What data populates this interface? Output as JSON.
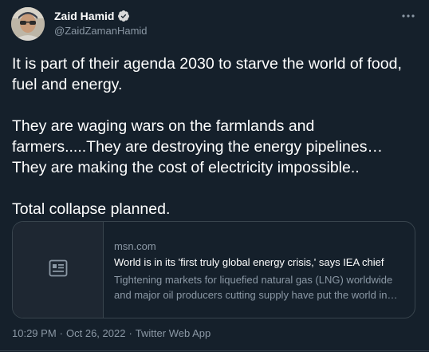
{
  "author": {
    "display_name": "Zaid Hamid",
    "handle": "@ZaidZamanHamid",
    "verified": true,
    "avatar_icon": "user-avatar-photo"
  },
  "tweet": {
    "paragraphs": [
      "It is part of their agenda 2030 to starve the world of food, fuel and energy.",
      "They are waging wars on the farmlands and farmers.....They are destroying the energy pipelines… They are making the cost of electricity impossible..",
      "Total collapse planned."
    ]
  },
  "link_card": {
    "domain": "msn.com",
    "title": "World is in its 'first truly global energy crisis,' says IEA chief",
    "description_line1": "Tightening markets for liquefied natural gas (LNG) worldwide",
    "description_line2": "and major oil producers cutting supply have put the world in…",
    "thumbnail_icon": "article-icon"
  },
  "meta": {
    "time": "10:29 PM",
    "separator": "·",
    "date": "Oct 26, 2022",
    "source": "Twitter Web App"
  },
  "colors": {
    "background": "#15202b",
    "text": "#ffffff",
    "secondary_text": "#8b98a5",
    "border": "#38444d",
    "verified_badge": "#d9d9d9"
  },
  "icons": {
    "more": "more-options-icon",
    "verified": "verified-badge-icon"
  }
}
